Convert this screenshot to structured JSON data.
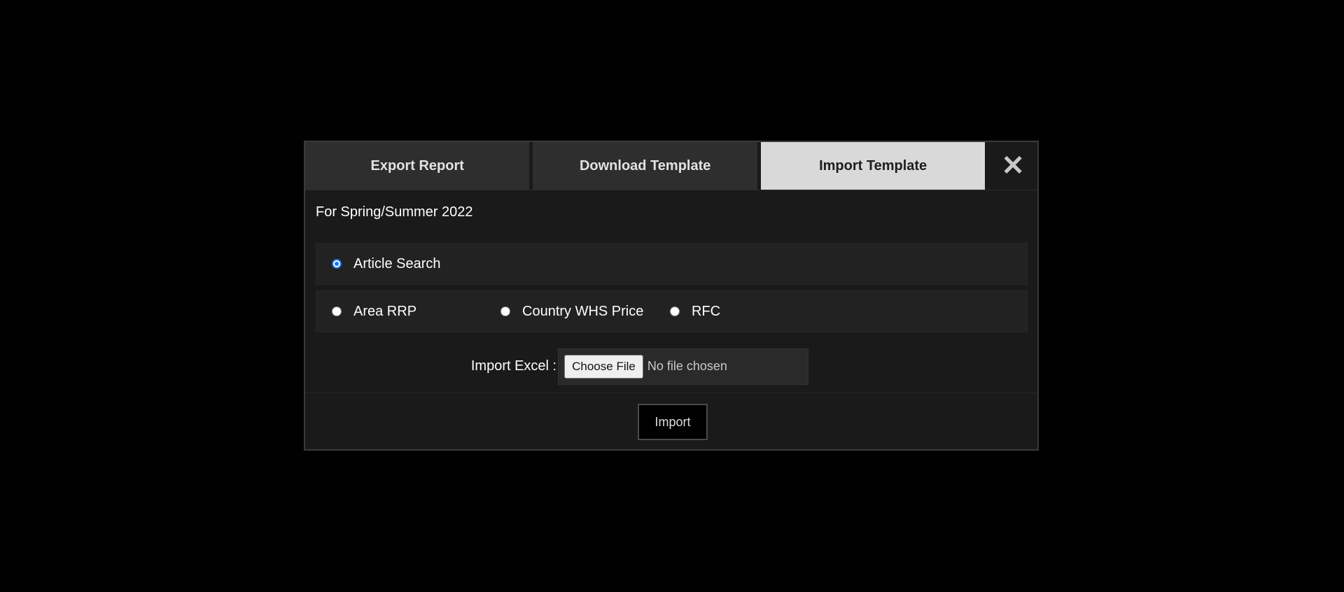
{
  "modal": {
    "tabs": [
      {
        "label": "Export Report",
        "active": false
      },
      {
        "label": "Download Template",
        "active": false
      },
      {
        "label": "Import Template",
        "active": true
      }
    ],
    "close_glyph": "✕",
    "season_text": "For Spring/Summer 2022",
    "options_row1": [
      {
        "label": "Article Search",
        "checked": true
      }
    ],
    "options_row2": [
      {
        "label": "Area RRP",
        "checked": false
      },
      {
        "label": "Country WHS Price",
        "checked": false
      },
      {
        "label": "RFC",
        "checked": false
      }
    ],
    "import_excel_label": "Import Excel :",
    "file_button_label": "Choose File",
    "file_status": "No file chosen",
    "import_button_label": "Import"
  },
  "colors": {
    "active_tab_bg": "#d9d9d9",
    "tab_bg": "#2e2e2e",
    "modal_bg": "#1a1a1a",
    "radio_accent": "#1a73e8"
  }
}
